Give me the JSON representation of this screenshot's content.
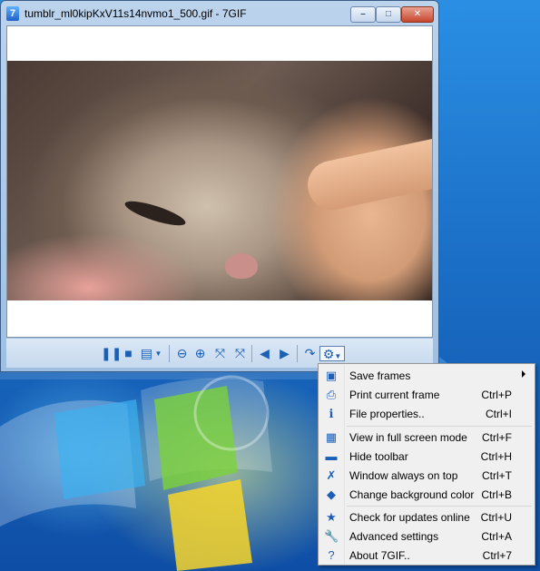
{
  "window": {
    "title": "tumblr_ml0kipKxV11s14nvmo1_500.gif - 7GIF",
    "app_icon_glyph": "7",
    "caption_buttons": {
      "minimize": "–",
      "maximize": "□",
      "close": "✕"
    }
  },
  "toolbar": {
    "buttons": [
      {
        "icon": "pause-icon",
        "glyph": "❚❚"
      },
      {
        "icon": "stop-icon",
        "glyph": "■"
      },
      {
        "icon": "frames-icon",
        "glyph": "▤"
      },
      {
        "icon": "zoom-out-icon",
        "glyph": "⊖"
      },
      {
        "icon": "zoom-in-icon",
        "glyph": "⊕"
      },
      {
        "icon": "fit-window-icon",
        "glyph": "⤧"
      },
      {
        "icon": "actual-size-icon",
        "glyph": "⤧"
      },
      {
        "icon": "previous-frame-icon",
        "glyph": "◀"
      },
      {
        "icon": "next-frame-icon",
        "glyph": "▶"
      },
      {
        "icon": "open-icon",
        "glyph": "↷"
      },
      {
        "icon": "settings-gear-icon",
        "glyph": "⚙"
      }
    ]
  },
  "menu": {
    "items": [
      {
        "label": "Save frames",
        "shortcut": "",
        "icon": "save-icon",
        "glyph": "▣",
        "submenu": true
      },
      {
        "label": "Print current frame",
        "shortcut": "Ctrl+P",
        "icon": "print-icon",
        "glyph": "⎙"
      },
      {
        "label": "File properties..",
        "shortcut": "Ctrl+I",
        "icon": "info-icon",
        "glyph": "ℹ"
      },
      {
        "label": "View in full screen mode",
        "shortcut": "Ctrl+F",
        "icon": "fullscreen-icon",
        "glyph": "▦"
      },
      {
        "label": "Hide toolbar",
        "shortcut": "Ctrl+H",
        "icon": "toolbar-icon",
        "glyph": "▬"
      },
      {
        "label": "Window always on top",
        "shortcut": "Ctrl+T",
        "icon": "pin-icon",
        "glyph": "✗"
      },
      {
        "label": "Change background color",
        "shortcut": "Ctrl+B",
        "icon": "paint-icon",
        "glyph": "◆"
      },
      {
        "label": "Check for updates online",
        "shortcut": "Ctrl+U",
        "icon": "star-icon",
        "glyph": "★"
      },
      {
        "label": "Advanced settings",
        "shortcut": "Ctrl+A",
        "icon": "wrench-icon",
        "glyph": "🔧"
      },
      {
        "label": "About 7GIF..",
        "shortcut": "Ctrl+7",
        "icon": "help-icon",
        "glyph": "?"
      }
    ]
  }
}
